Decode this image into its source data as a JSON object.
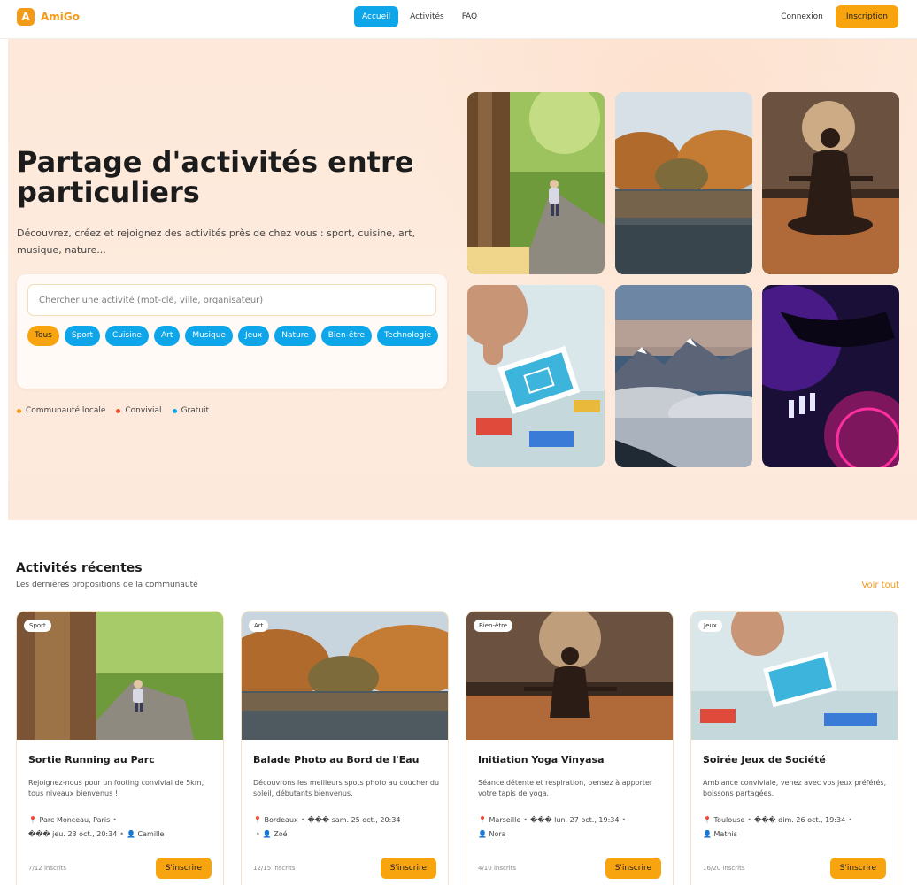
{
  "nav": {
    "logo_letter": "A",
    "brand": "AmiGo",
    "links": [
      "Accueil",
      "Activités",
      "FAQ"
    ],
    "login": "Connexion",
    "signup": "Inscription"
  },
  "hero": {
    "title": "Partage d'activités entre particuliers",
    "subtitle": "Découvrez, créez et rejoignez des activités près de chez vous : sport, cuisine, art, musique, nature...",
    "search_placeholder": "Chercher une activité (mot-clé, ville, organisateur)",
    "chips": [
      "Tous",
      "Sport",
      "Cuisine",
      "Art",
      "Musique",
      "Jeux",
      "Nature",
      "Bien-être",
      "Technologie"
    ],
    "legend": [
      {
        "label": "Communauté locale",
        "color": "#f39a16"
      },
      {
        "label": "Convivial",
        "color": "#f0532b"
      },
      {
        "label": "Gratuit",
        "color": "#0ea5e9"
      }
    ]
  },
  "recent": {
    "title": "Activités récentes",
    "subtitle": "Les dernières propositions de la communauté",
    "see_all": "Voir tout",
    "cards": [
      {
        "badge": "Sport",
        "title": "Sortie Running au Parc",
        "desc": "Rejoignez-nous pour un footing convivial de 5km, tous niveaux bienvenus !",
        "location": "Parc Monceau, Paris",
        "date": "��� jeu. 23 oct., 20:34",
        "organizer": "Camille",
        "count": "7/12 inscrits",
        "button": "S'inscrire"
      },
      {
        "badge": "Art",
        "title": "Balade Photo au Bord de l'Eau",
        "desc": "Découvrons les meilleurs spots photo au coucher du soleil, débutants bienvenus.",
        "location": "Bordeaux",
        "date": "��� sam. 25 oct., 20:34",
        "organizer": "Zoé",
        "count": "12/15 inscrits",
        "button": "S'inscrire"
      },
      {
        "badge": "Bien-être",
        "title": "Initiation Yoga Vinyasa",
        "desc": "Séance détente et respiration, pensez à apporter votre tapis de yoga.",
        "location": "Marseille",
        "date": "��� lun. 27 oct., 19:34",
        "organizer": "Nora",
        "count": "4/10 inscrits",
        "button": "S'inscrire"
      },
      {
        "badge": "Jeux",
        "title": "Soirée Jeux de Société",
        "desc": "Ambiance conviviale, venez avec vos jeux préférés, boissons partagées.",
        "location": "Toulouse",
        "date": "��� dim. 26 oct., 19:34",
        "organizer": "Mathis",
        "count": "16/20 inscrits",
        "button": "S'inscrire"
      }
    ]
  }
}
